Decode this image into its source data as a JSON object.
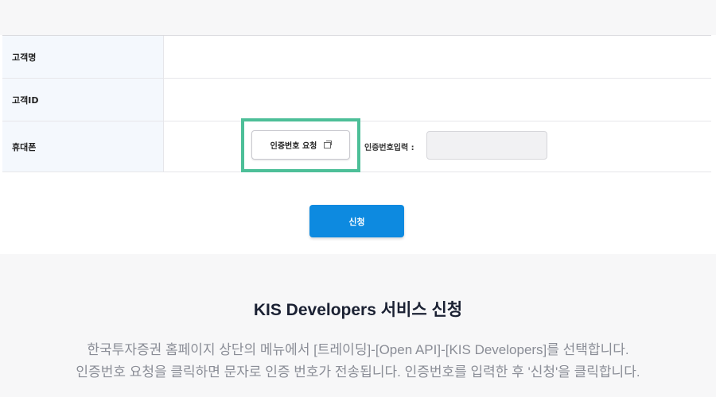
{
  "form": {
    "rows": [
      {
        "label": "고객명"
      },
      {
        "label": "고객ID"
      },
      {
        "label": "휴대폰"
      }
    ],
    "request_code_button": "인증번호 요청",
    "code_input_label": "인증번호입력 :",
    "code_input_value": ""
  },
  "submit_button": "신청",
  "info": {
    "title": "KIS Developers 서비스 신청",
    "line1": "한국투자증권 홈페이지 상단의 메뉴에서 [트레이딩]-[Open API]-[KIS Developers]를 선택합니다.",
    "line2": "인증번호 요청을 클릭하면 문자로 인증 번호가 전송됩니다. 인증번호를 입력한 후 '신청'을 클릭합니다."
  },
  "colors": {
    "highlight": "#4dbf98",
    "primary_button": "#0d8ae0"
  }
}
